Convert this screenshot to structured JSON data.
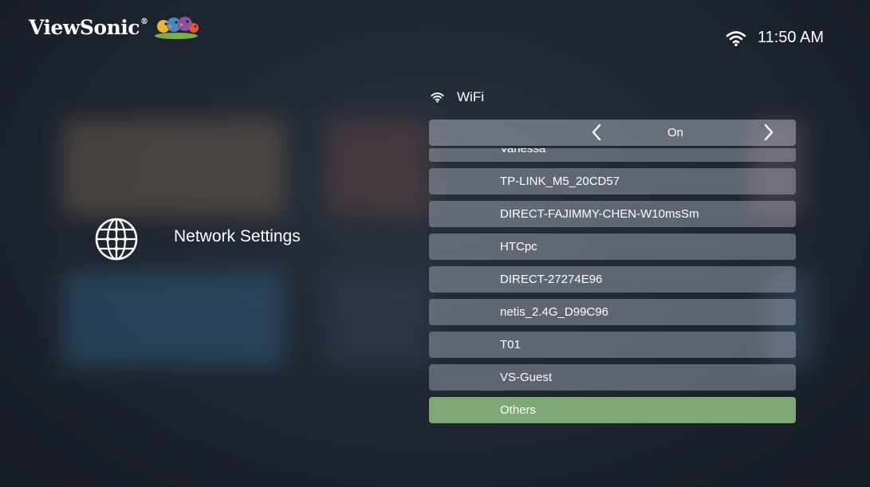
{
  "brand": {
    "name": "ViewSonic",
    "reg": "®"
  },
  "status_bar": {
    "wifi_icon": "wifi-icon",
    "time": "11:50 AM"
  },
  "page": {
    "title": "Network Settings",
    "icon": "globe-icon"
  },
  "wifi": {
    "header_label": "WiFi",
    "toggle": {
      "value": "On",
      "prev_icon": "chevron-left-icon",
      "next_icon": "chevron-right-icon"
    },
    "networks": [
      {
        "ssid": "Vanessa",
        "selected": false
      },
      {
        "ssid": "TP-LINK_M5_20CD57",
        "selected": false
      },
      {
        "ssid": "DIRECT-FAJIMMY-CHEN-W10msSm",
        "selected": false
      },
      {
        "ssid": "HTCpc",
        "selected": false
      },
      {
        "ssid": "DIRECT-27274E96",
        "selected": false
      },
      {
        "ssid": "netis_2.4G_D99C96",
        "selected": false
      },
      {
        "ssid": "T01",
        "selected": false
      },
      {
        "ssid": "VS-Guest",
        "selected": false
      },
      {
        "ssid": "Others",
        "selected": true
      }
    ]
  },
  "colors": {
    "selected_row": "#7ea877",
    "row": "#cdd4de",
    "background": "#262e3b"
  }
}
